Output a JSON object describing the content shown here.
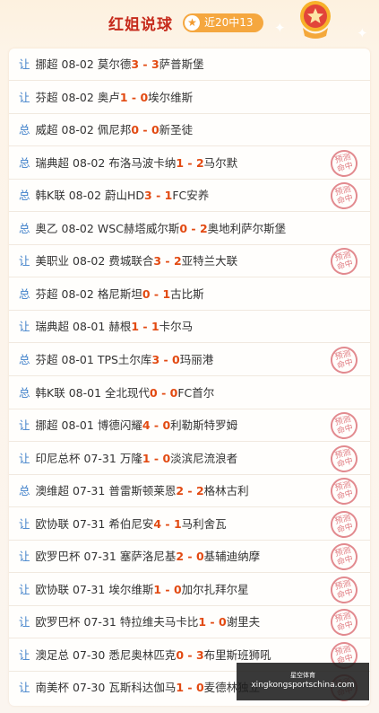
{
  "header": {
    "title": "红姐说球",
    "record_icon": "star-icon",
    "record": "近20中13"
  },
  "stamp": {
    "line1": "预测",
    "line2": "命中"
  },
  "matches": [
    {
      "tag": "让",
      "league": "挪超",
      "date": "08-02",
      "home": "莫尔德",
      "hs": "3",
      "sep": " - ",
      "as": "3",
      "away": "萨普斯堡",
      "hit": false
    },
    {
      "tag": "让",
      "league": "芬超",
      "date": "08-02",
      "home": "奥卢",
      "hs": "1",
      "sep": " - ",
      "as": "0",
      "away": "埃尔维斯",
      "hit": false
    },
    {
      "tag": "总",
      "league": "威超",
      "date": "08-02",
      "home": "佩尼邦",
      "hs": "0",
      "sep": " - ",
      "as": "0",
      "away": "新圣徒",
      "hit": false
    },
    {
      "tag": "总",
      "league": "瑞典超",
      "date": "08-02",
      "home": "布洛马波卡纳",
      "hs": "1",
      "sep": " - ",
      "as": "2",
      "away": "马尔默",
      "hit": true
    },
    {
      "tag": "总",
      "league": "韩K联",
      "date": "08-02",
      "home": "蔚山HD",
      "hs": "3",
      "sep": " - ",
      "as": "1",
      "away": "FC安养",
      "hit": true
    },
    {
      "tag": "总",
      "league": "奥乙",
      "date": "08-02",
      "home": "WSC赫塔威尔斯",
      "hs": "0",
      "sep": " - ",
      "as": "2",
      "away": "奥地利萨尔斯堡",
      "hit": false
    },
    {
      "tag": "让",
      "league": "美职业",
      "date": "08-02",
      "home": "费城联合",
      "hs": "3",
      "sep": " - ",
      "as": "2",
      "away": "亚特兰大联",
      "hit": true
    },
    {
      "tag": "总",
      "league": "芬超",
      "date": "08-02",
      "home": "格尼斯坦",
      "hs": "0",
      "sep": " - ",
      "as": "1",
      "away": "古比斯",
      "hit": false
    },
    {
      "tag": "让",
      "league": "瑞典超",
      "date": "08-01",
      "home": "赫根",
      "hs": "1",
      "sep": " - ",
      "as": "1",
      "away": "卡尔马",
      "hit": false
    },
    {
      "tag": "总",
      "league": "芬超",
      "date": "08-01",
      "home": "TPS土尔库",
      "hs": "3",
      "sep": " - ",
      "as": "0",
      "away": "玛丽港",
      "hit": true
    },
    {
      "tag": "总",
      "league": "韩K联",
      "date": "08-01",
      "home": "全北现代",
      "hs": "0",
      "sep": " - ",
      "as": "0",
      "away": "FC首尔",
      "hit": false
    },
    {
      "tag": "让",
      "league": "挪超",
      "date": "08-01",
      "home": "博德闪耀",
      "hs": "4",
      "sep": " - ",
      "as": "0",
      "away": "利勒斯特罗姆",
      "hit": true
    },
    {
      "tag": "让",
      "league": "印尼总杯",
      "date": "07-31",
      "home": "万隆",
      "hs": "1",
      "sep": " - ",
      "as": "0",
      "away": "淡滨尼流浪者",
      "hit": true
    },
    {
      "tag": "总",
      "league": "澳维超",
      "date": "07-31",
      "home": "普雷斯顿莱恩",
      "hs": "2",
      "sep": " - ",
      "as": "2",
      "away": "格林古利",
      "hit": true
    },
    {
      "tag": "让",
      "league": "欧协联",
      "date": "07-31",
      "home": "希伯尼安",
      "hs": "4",
      "sep": " - ",
      "as": "1",
      "away": "马利舍瓦",
      "hit": true
    },
    {
      "tag": "让",
      "league": "欧罗巴杯",
      "date": "07-31",
      "home": "塞萨洛尼基",
      "hs": "2",
      "sep": " - ",
      "as": "0",
      "away": "基辅迪纳摩",
      "hit": true
    },
    {
      "tag": "让",
      "league": "欧协联",
      "date": "07-31",
      "home": "埃尔维斯",
      "hs": "1",
      "sep": " - ",
      "as": "0",
      "away": "加尔扎拜尔星",
      "hit": true
    },
    {
      "tag": "让",
      "league": "欧罗巴杯",
      "date": "07-31",
      "home": "特拉维夫马卡比",
      "hs": "1",
      "sep": " - ",
      "as": "0",
      "away": "谢里夫",
      "hit": true
    },
    {
      "tag": "让",
      "league": "澳足总",
      "date": "07-30",
      "home": "悉尼奥林匹克",
      "hs": "0",
      "sep": " - ",
      "as": "3",
      "away": "布里斯班狮吼",
      "hit": true
    },
    {
      "tag": "让",
      "league": "南美杯",
      "date": "07-30",
      "home": "瓦斯科达伽马",
      "hs": "1",
      "sep": " - ",
      "as": "0",
      "away": "麦德林独立",
      "hit": true
    }
  ],
  "watermark": {
    "line1": "星空体育",
    "line2": "xingkongsportschina.com"
  }
}
